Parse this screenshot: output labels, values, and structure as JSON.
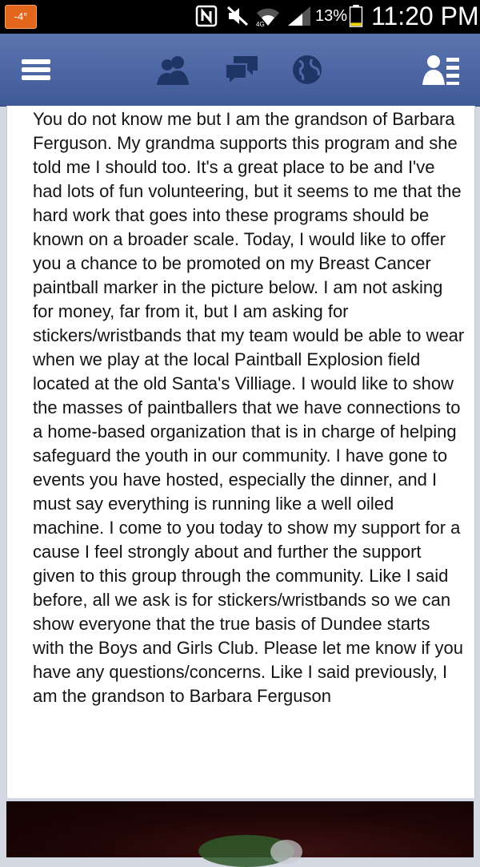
{
  "status_bar": {
    "notification": "-4°",
    "battery_percent": "13%",
    "time": "11:20 PM",
    "icons": [
      "nfc-icon",
      "mute-icon",
      "wifi-icon",
      "signal-icon",
      "battery-icon"
    ]
  },
  "toolbar": {
    "icons": [
      "menu-icon",
      "friend-requests-icon",
      "messages-icon",
      "notifications-globe-icon",
      "online-friends-icon"
    ],
    "bar_color": "#4a65a3"
  },
  "post": {
    "text": "You do not know me but I am the grandson of Barbara Ferguson. My grandma supports this program and she told me I should too. It's a great place to be and I've had lots of fun volunteering, but it seems to me that the hard work that goes into these programs should be known on a broader scale. Today, I would like to offer you a chance to be promoted on my Breast Cancer paintball marker in the picture below. I am not asking for money, far from it, but I am asking for stickers/wristbands that my team would be able to wear when we play at the local Paintball Explosion field located at the old Santa's Villiage. I would like to show the masses of paintballers that we have connections to a home-based organization that is in charge of helping safeguard the youth in our community. I have gone to events you have hosted, especially the dinner, and I must say everything is running like a well oiled machine. I come to you today to show my support for a cause I feel strongly about and further the support given to this group through the community. Like I said before, all we ask is for stickers/wristbands so we can show everyone that the true basis of Dundee starts with the Boys and Girls Club. Please let me know if you have any questions/concerns. Like I said previously, I am the grandson to Barbara Ferguson"
  }
}
